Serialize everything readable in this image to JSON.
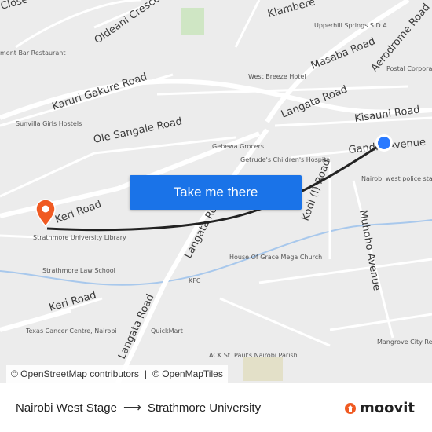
{
  "map": {
    "road_labels": [
      "Karuri Gakure Road",
      "Ole Sangale Road",
      "Langata Road",
      "Keri Road",
      "Kisauni Road",
      "Gandhi Avenue",
      "Masaba Road",
      "Aerodrome Road",
      "Kodi (I) Road",
      "Muhoho Avenue",
      "Oldeani Crescent",
      "Klambere",
      "Close"
    ],
    "poi_labels": [
      "Upperhill Springs S.D.A",
      "West Breeze Hotel",
      "Postal Corpora",
      "Sunvilla Girls Hostels",
      "Gebewa Grocers",
      "Getrude's Children's Hospital",
      "Nairobi west police station",
      "Strathmore University Library",
      "Strathmore Law School",
      "House Of Grace Mega Church",
      "KFC",
      "QuickMart",
      "Texas Cancer Centre, Nairobi",
      "ACK St. Paul's Nairobi Parish",
      "Mangrove City Restaurant a",
      "mont Bar Restaurant"
    ]
  },
  "cta": {
    "label": "Take me there"
  },
  "attribution": {
    "osm_contrib": "© OpenStreetMap contributors",
    "separator": "|",
    "omt": "© OpenMapTiles"
  },
  "route": {
    "from": "Nairobi West Stage",
    "to": "Strathmore University"
  },
  "brand": {
    "name": "moovit",
    "color": "#f05a22"
  },
  "colors": {
    "route_line": "#222222",
    "origin_marker": "#2979ff",
    "destination_marker": "#f05a22",
    "cta_bg": "#1a73e8"
  },
  "icons": {
    "arrow": "right-arrow-icon"
  }
}
